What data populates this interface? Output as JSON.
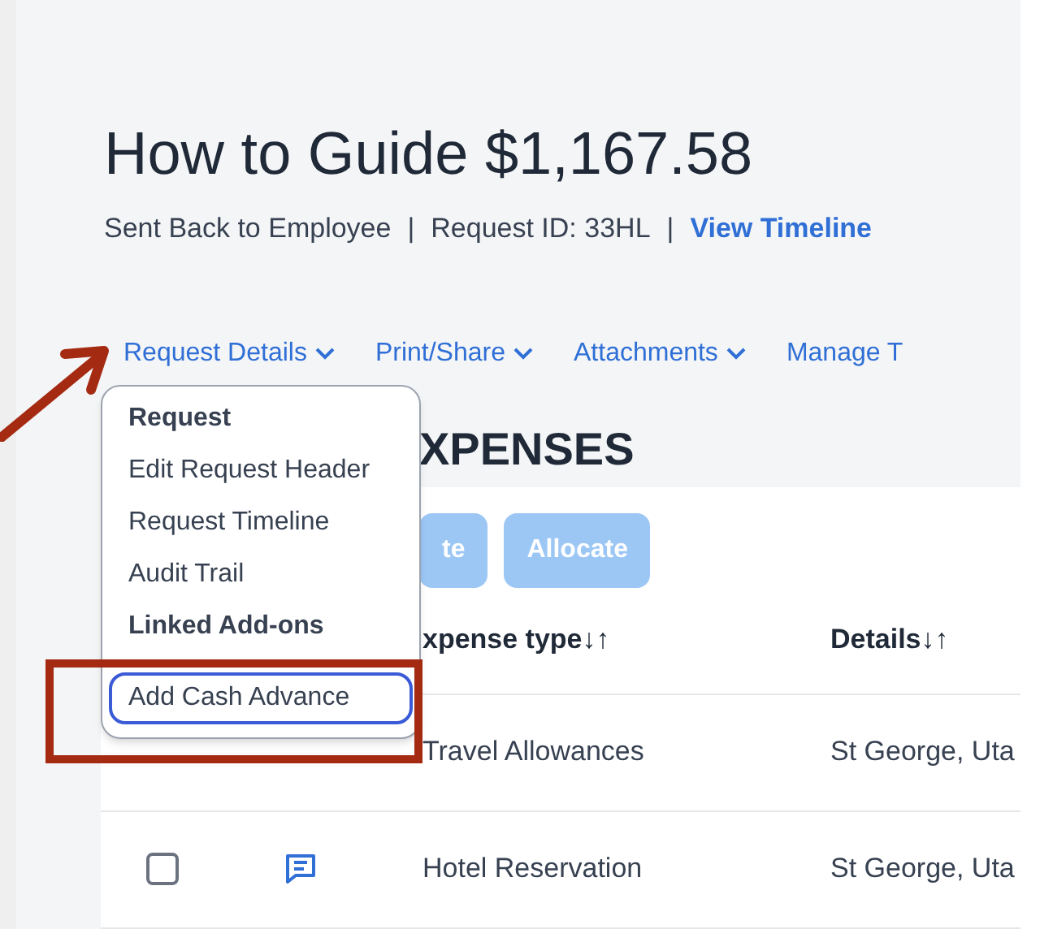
{
  "title": "How to Guide $1,167.58",
  "status_line": [
    "Sent Back to Employee",
    "|",
    "Request ID: 33HL",
    "|"
  ],
  "status_link": "View Timeline",
  "nav": [
    {
      "label": "Request Details",
      "chevron": true
    },
    {
      "label": "Print/Share",
      "chevron": true
    },
    {
      "label": "Attachments",
      "chevron": true
    },
    {
      "label": "Manage T",
      "chevron": false
    }
  ],
  "dropdown": [
    {
      "kind": "heading",
      "label": "Request"
    },
    {
      "kind": "item",
      "label": "Edit Request Header",
      "focused": false
    },
    {
      "kind": "item",
      "label": "Request Timeline",
      "focused": false
    },
    {
      "kind": "item",
      "label": "Audit Trail",
      "focused": false
    },
    {
      "kind": "heading",
      "label": "Linked Add-ons"
    },
    {
      "kind": "item",
      "label": "Add Cash Advance",
      "focused": true
    }
  ],
  "section_title": "XPENSES",
  "buttons": [
    "te",
    "Allocate"
  ],
  "table": {
    "columns": [
      "xpense type↓↑",
      "Details↓↑"
    ],
    "rows": [
      {
        "comment": false,
        "cells": [
          "Travel Allowances",
          "St George, Uta"
        ]
      },
      {
        "checked": false,
        "comment": true,
        "cells": [
          "Hotel Reservation",
          "St George, Uta"
        ]
      }
    ]
  }
}
